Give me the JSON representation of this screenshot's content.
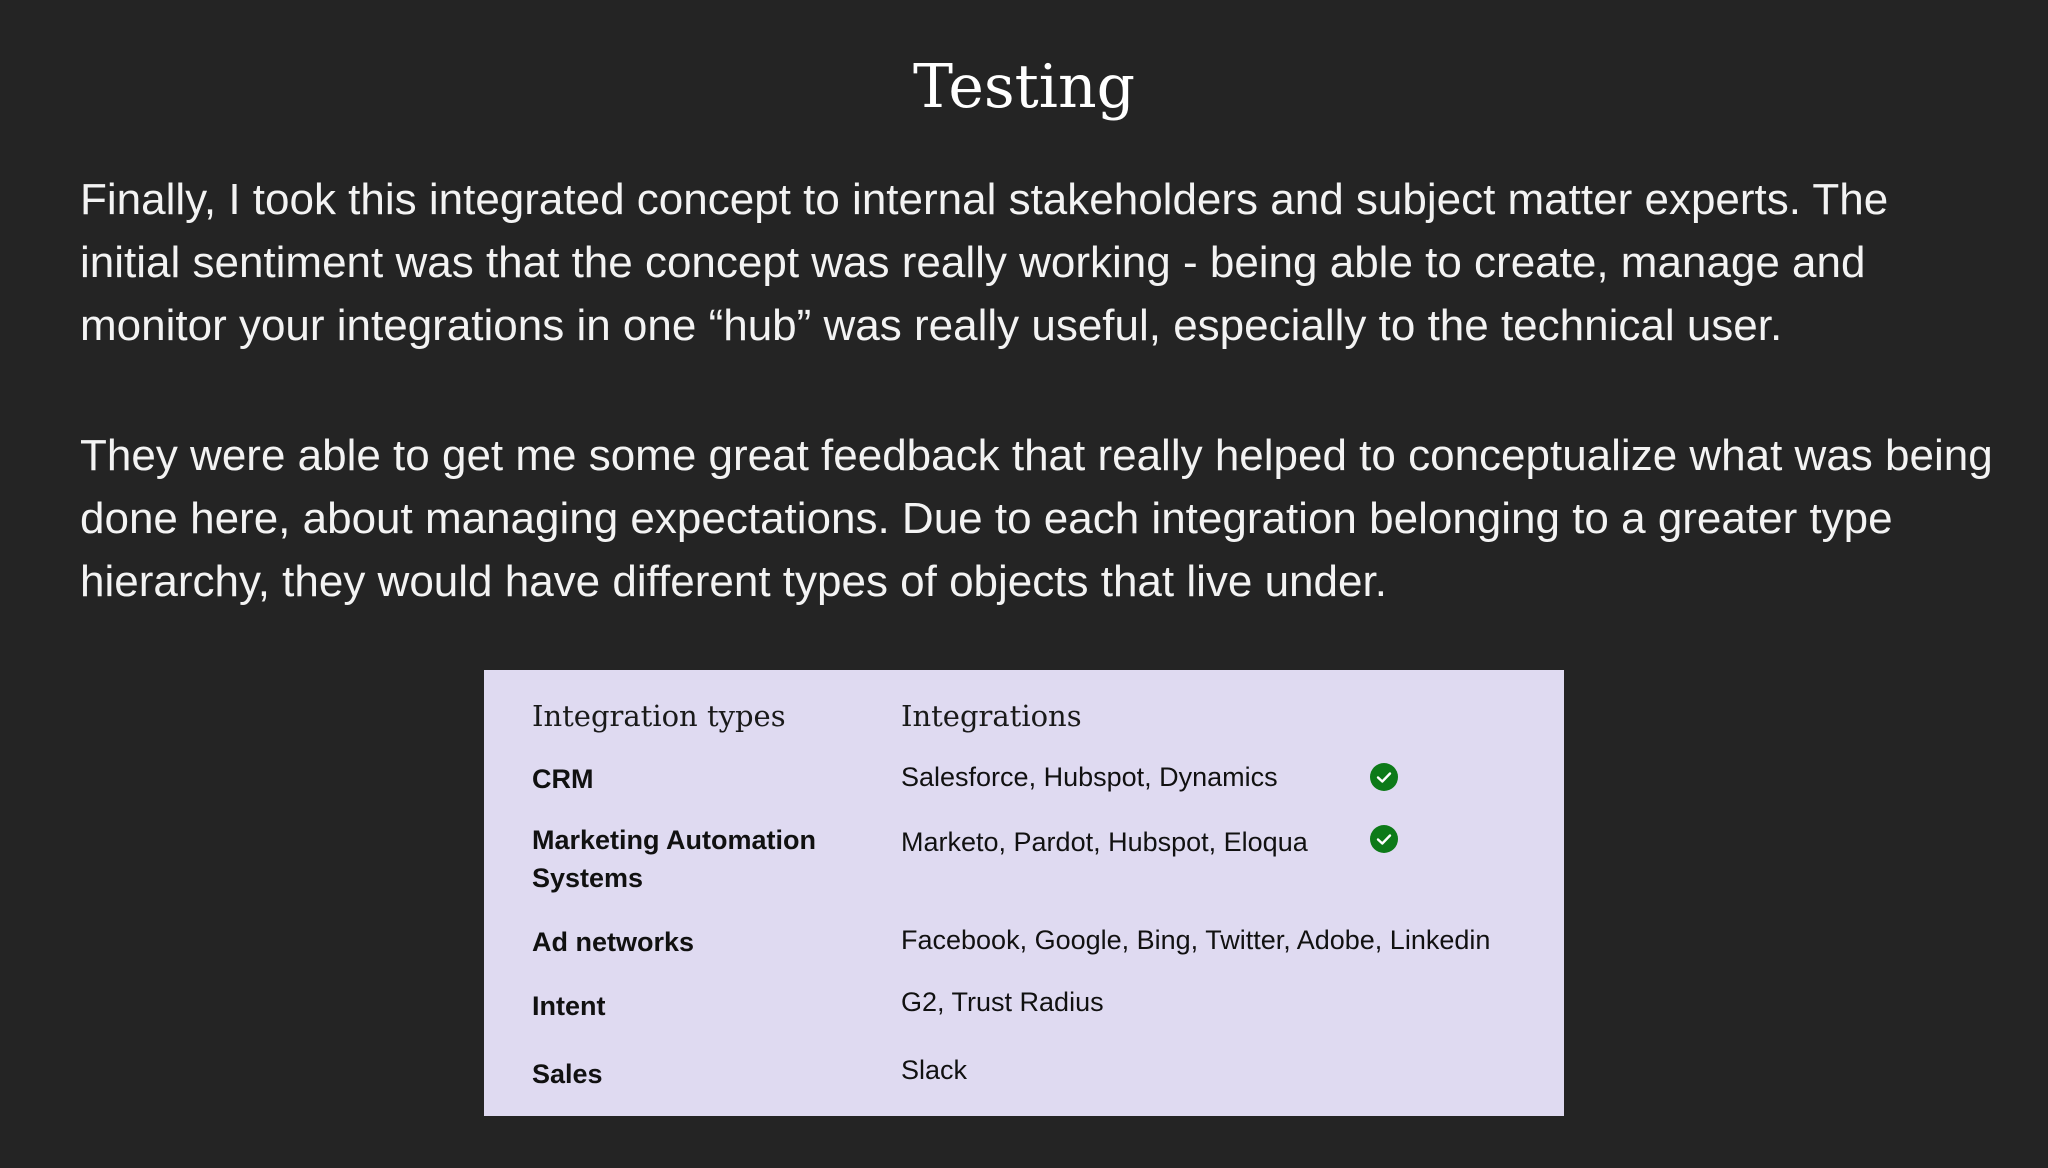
{
  "title": "Testing",
  "paragraphs": [
    "Finally, I took this integrated concept to internal stakeholders and subject matter experts. The initial sentiment was that the concept was really working - being able to create, manage and monitor your integrations in one “hub” was really useful, especially to the technical user.",
    "They were able to get me some great feedback that really helped to conceptualize what was being done here, about managing expectations. Due to each integration belonging to a greater type hierarchy, they would have different types of objects that live under."
  ],
  "table": {
    "headers": {
      "types": "Integration types",
      "integrations": "Integrations"
    },
    "rows": [
      {
        "type": "CRM",
        "integrations": "Salesforce, Hubspot, Dynamics",
        "checked": true,
        "check_icon": "check-circle-icon"
      },
      {
        "type": "Marketing Automation Systems",
        "integrations": "Marketo, Pardot, Hubspot, Eloqua",
        "checked": true,
        "check_icon": "check-circle-icon"
      },
      {
        "type": "Ad networks",
        "integrations": "Facebook, Google, Bing, Twitter, Adobe, Linkedin",
        "checked": false
      },
      {
        "type": "Intent",
        "integrations": "G2, Trust Radius",
        "checked": false
      },
      {
        "type": "Sales",
        "integrations": "Slack",
        "checked": false
      }
    ]
  },
  "colors": {
    "background": "#242424",
    "table_background": "#dfdaf1",
    "check_green": "#0d7a19"
  }
}
